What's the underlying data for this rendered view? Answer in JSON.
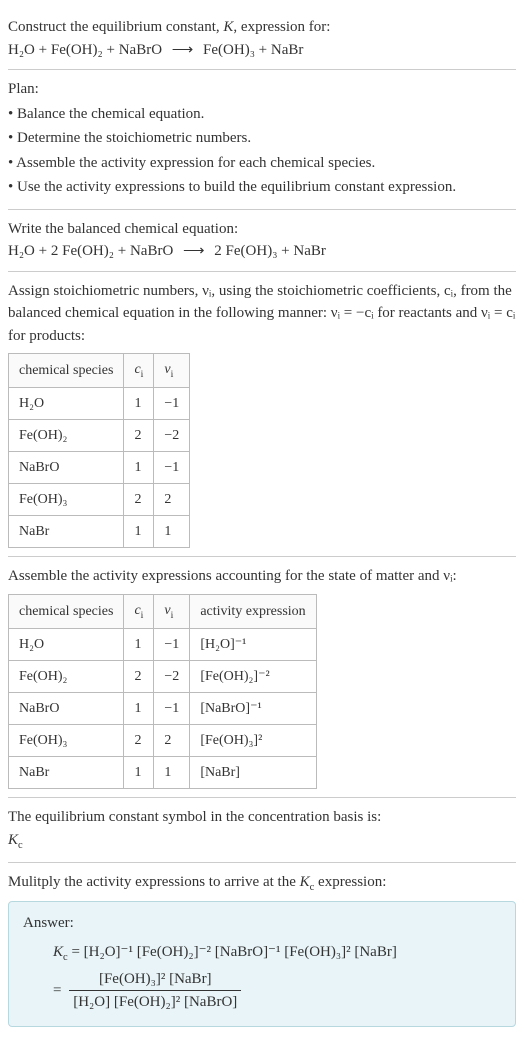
{
  "header": {
    "line1": "Construct the equilibrium constant, K, expression for:",
    "eq_lhs": "H₂O + Fe(OH)₂ + NaBrO",
    "eq_arrow": "⟶",
    "eq_rhs": "Fe(OH)₃ + NaBr"
  },
  "plan": {
    "title": "Plan:",
    "b1": "• Balance the chemical equation.",
    "b2": "• Determine the stoichiometric numbers.",
    "b3": "• Assemble the activity expression for each chemical species.",
    "b4": "• Use the activity expressions to build the equilibrium constant expression."
  },
  "balanced": {
    "label": "Write the balanced chemical equation:",
    "eq_lhs": "H₂O + 2 Fe(OH)₂ + NaBrO",
    "eq_arrow": "⟶",
    "eq_rhs": "2 Fe(OH)₃ + NaBr"
  },
  "assign": {
    "text": "Assign stoichiometric numbers, νᵢ, using the stoichiometric coefficients, cᵢ, from the balanced chemical equation in the following manner: νᵢ = −cᵢ for reactants and νᵢ = cᵢ for products:"
  },
  "table1": {
    "h1": "chemical species",
    "h2": "cᵢ",
    "h3": "νᵢ",
    "rows": [
      {
        "s": "H₂O",
        "c": "1",
        "v": "−1"
      },
      {
        "s": "Fe(OH)₂",
        "c": "2",
        "v": "−2"
      },
      {
        "s": "NaBrO",
        "c": "1",
        "v": "−1"
      },
      {
        "s": "Fe(OH)₃",
        "c": "2",
        "v": "2"
      },
      {
        "s": "NaBr",
        "c": "1",
        "v": "1"
      }
    ]
  },
  "assemble": {
    "text": "Assemble the activity expressions accounting for the state of matter and νᵢ:"
  },
  "table2": {
    "h1": "chemical species",
    "h2": "cᵢ",
    "h3": "νᵢ",
    "h4": "activity expression",
    "rows": [
      {
        "s": "H₂O",
        "c": "1",
        "v": "−1",
        "a": "[H₂O]⁻¹"
      },
      {
        "s": "Fe(OH)₂",
        "c": "2",
        "v": "−2",
        "a": "[Fe(OH)₂]⁻²"
      },
      {
        "s": "NaBrO",
        "c": "1",
        "v": "−1",
        "a": "[NaBrO]⁻¹"
      },
      {
        "s": "Fe(OH)₃",
        "c": "2",
        "v": "2",
        "a": "[Fe(OH)₃]²"
      },
      {
        "s": "NaBr",
        "c": "1",
        "v": "1",
        "a": "[NaBr]"
      }
    ]
  },
  "symbol": {
    "line1": "The equilibrium constant symbol in the concentration basis is:",
    "kc": "K_c"
  },
  "multiply": {
    "text": "Mulitply the activity expressions to arrive at the K_c expression:"
  },
  "answer": {
    "label": "Answer:",
    "lhs": "K_c = ",
    "flat": "[H₂O]⁻¹ [Fe(OH)₂]⁻² [NaBrO]⁻¹ [Fe(OH)₃]² [NaBr]",
    "eq2_prefix": "= ",
    "num": "[Fe(OH)₃]² [NaBr]",
    "den": "[H₂O] [Fe(OH)₂]² [NaBrO]"
  }
}
